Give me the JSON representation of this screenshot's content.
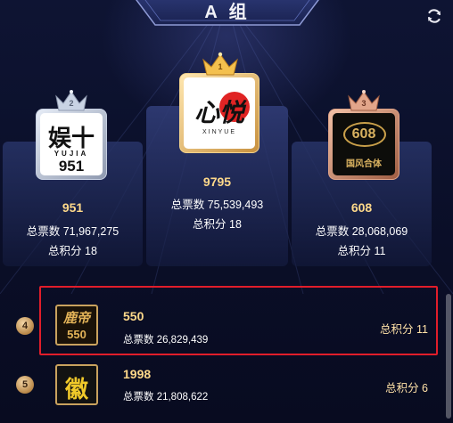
{
  "header": {
    "title": "A 组",
    "refresh_icon": "refresh-icon"
  },
  "labels": {
    "votes_prefix": "总票数",
    "score_prefix": "总积分"
  },
  "podium": [
    {
      "rank": "2",
      "name": "951",
      "votes": "总票数 71,967,275",
      "score": "总积分 18",
      "logo_text": "娱十",
      "logo_sub": "YUJIA",
      "logo_num": "951"
    },
    {
      "rank": "1",
      "name": "9795",
      "votes": "总票数 75,539,493",
      "score": "总积分 18",
      "logo_text": "心悦",
      "logo_sub": "XINYUE"
    },
    {
      "rank": "3",
      "name": "608",
      "votes": "总票数 28,068,069",
      "score": "总积分 11",
      "logo_text": "608",
      "logo_sub": "国风合体"
    }
  ],
  "list": [
    {
      "rank": "4",
      "name": "550",
      "votes": "总票数 26,829,439",
      "score": "总积分 11",
      "logo_text": "鹿帝",
      "logo_num": "550"
    },
    {
      "rank": "5",
      "name": "1998",
      "votes": "总票数 21,808,622",
      "score": "总积分 6",
      "logo_text": "徽"
    }
  ],
  "colors": {
    "gold": "#ffd98a",
    "silver": "#b8c4d8",
    "bronze": "#c88a6a",
    "highlight_border": "#e11d2a"
  }
}
